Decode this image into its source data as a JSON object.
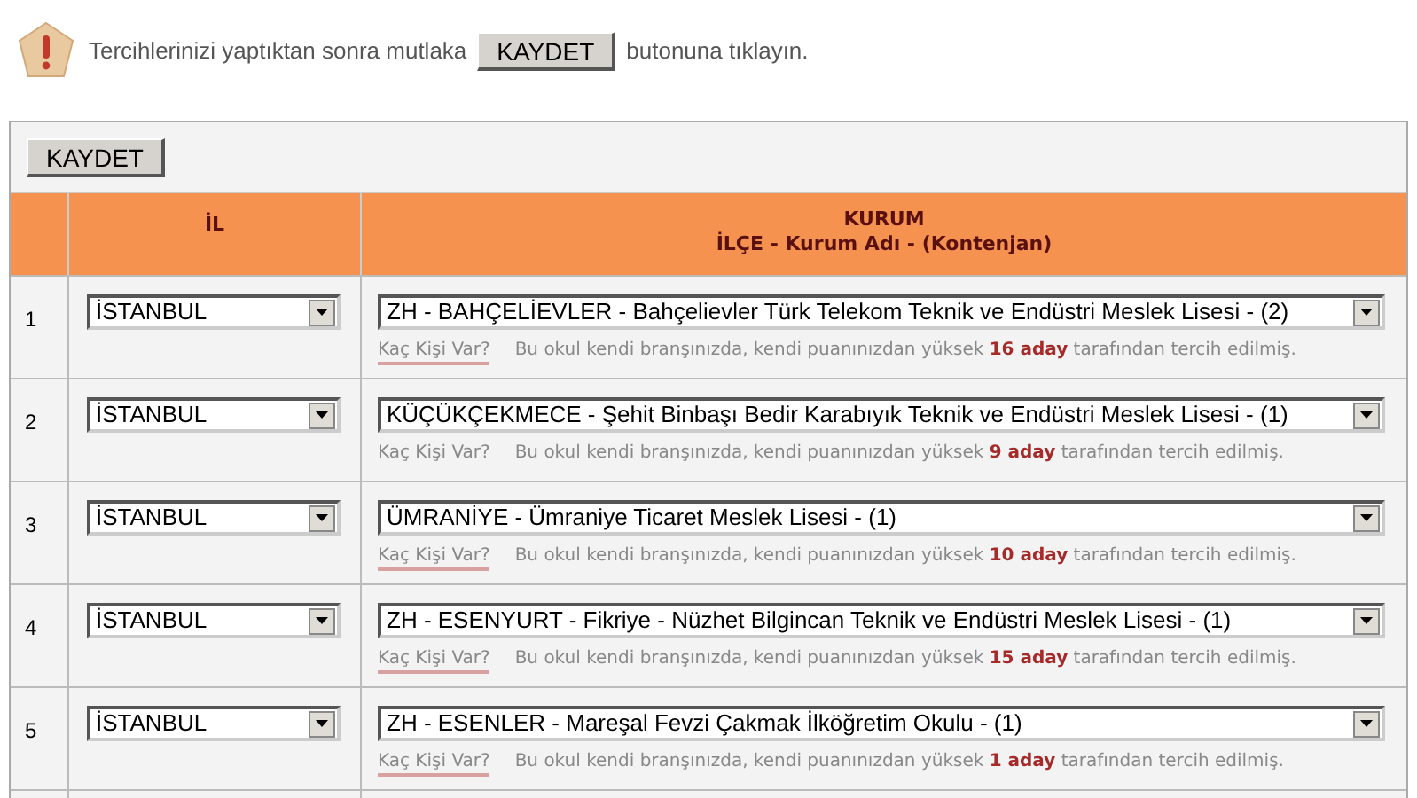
{
  "notice": {
    "text_before": "Tercihlerinizi yaptıktan sonra mutlaka",
    "button": "KAYDET",
    "text_after": "butonuna tıklayın."
  },
  "toolbar": {
    "button": "KAYDET"
  },
  "table": {
    "columns": [
      {
        "label": "İL"
      },
      {
        "label": "KURUM",
        "sublabel": "İLÇE - Kurum Adı - (Kontenjan)"
      }
    ],
    "rows": [
      {
        "number": "1",
        "city": "İSTANBUL",
        "school": "ZH - BAHÇELİEVLER - Bahçelievler Türk Telekom Teknik ve Endüstri Meslek Lisesi - (2)",
        "link": "Kaç Kişi Var?",
        "link_underlined": true,
        "info": "Bu okul kendi branşınızda, kendi puanınızdan yüksek **16 aday** tarafından tercih edilmiş."
      },
      {
        "number": "2",
        "city": "İSTANBUL",
        "school": "KÜÇÜKÇEKMECE - Şehit Binbaşı Bedir Karabıyık Teknik ve Endüstri Meslek Lisesi - (1)",
        "link": "Kaç Kişi Var?",
        "link_underlined": false,
        "info": "Bu okul kendi branşınızda, kendi puanınızdan yüksek **9 aday** tarafından tercih edilmiş."
      },
      {
        "number": "3",
        "city": "İSTANBUL",
        "school": "ÜMRANİYE - Ümraniye Ticaret Meslek Lisesi - (1)",
        "link": "Kaç Kişi Var?",
        "link_underlined": true,
        "info": "Bu okul kendi branşınızda, kendi puanınızdan yüksek **10 aday** tarafından tercih edilmiş."
      },
      {
        "number": "4",
        "city": "İSTANBUL",
        "school": "ZH - ESENYURT - Fikriye - Nüzhet Bilgincan Teknik ve Endüstri Meslek Lisesi - (1)",
        "link": "Kaç Kişi Var?",
        "link_underlined": true,
        "info": "Bu okul kendi branşınızda, kendi puanınızdan yüksek **15 aday** tarafından tercih edilmiş."
      },
      {
        "number": "5",
        "city": "İSTANBUL",
        "school": "ZH - ESENLER - Mareşal Fevzi Çakmak İlköğretim Okulu - (1)",
        "link": "Kaç Kişi Var?",
        "link_underlined": true,
        "info": "Bu okul kendi branşınızda, kendi puanınızdan yüksek **1 aday** tarafından tercih edilmiş."
      }
    ]
  }
}
